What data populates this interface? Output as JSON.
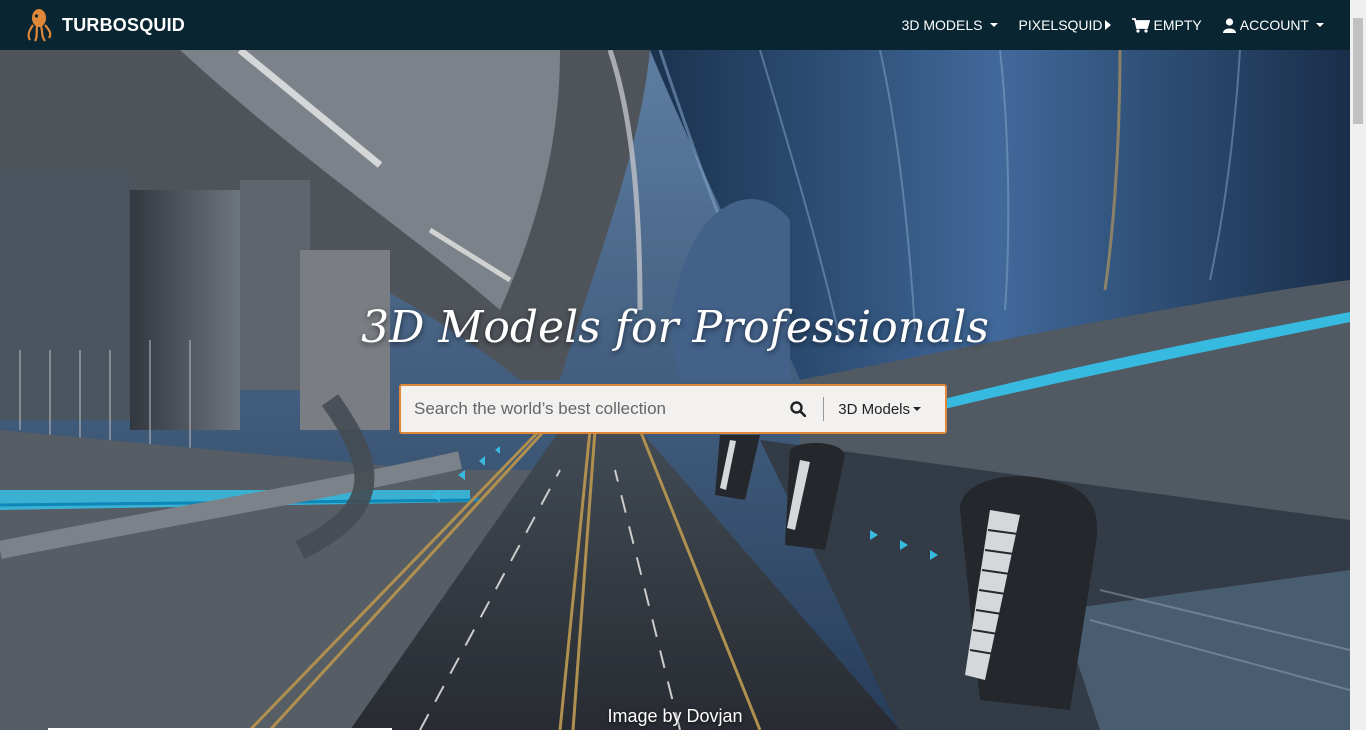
{
  "brand": {
    "name": "TURBOSQUID",
    "logo_icon": "squid-logo-icon",
    "accent": "#e0883a"
  },
  "nav": {
    "models_label": "3D MODELS",
    "pixelsquid_label": "PIXELSQUID",
    "cart_label": "EMPTY",
    "account_label": "ACCOUNT"
  },
  "hero": {
    "headline": "3D Models for Professionals",
    "credit": "Image by Dovjan"
  },
  "search": {
    "placeholder": "Search the world’s best collection",
    "value": "",
    "scope_label": "3D Models"
  },
  "colors": {
    "topbar": "#082531",
    "search_border": "#e0883a",
    "neon": "#3fd4ff"
  }
}
